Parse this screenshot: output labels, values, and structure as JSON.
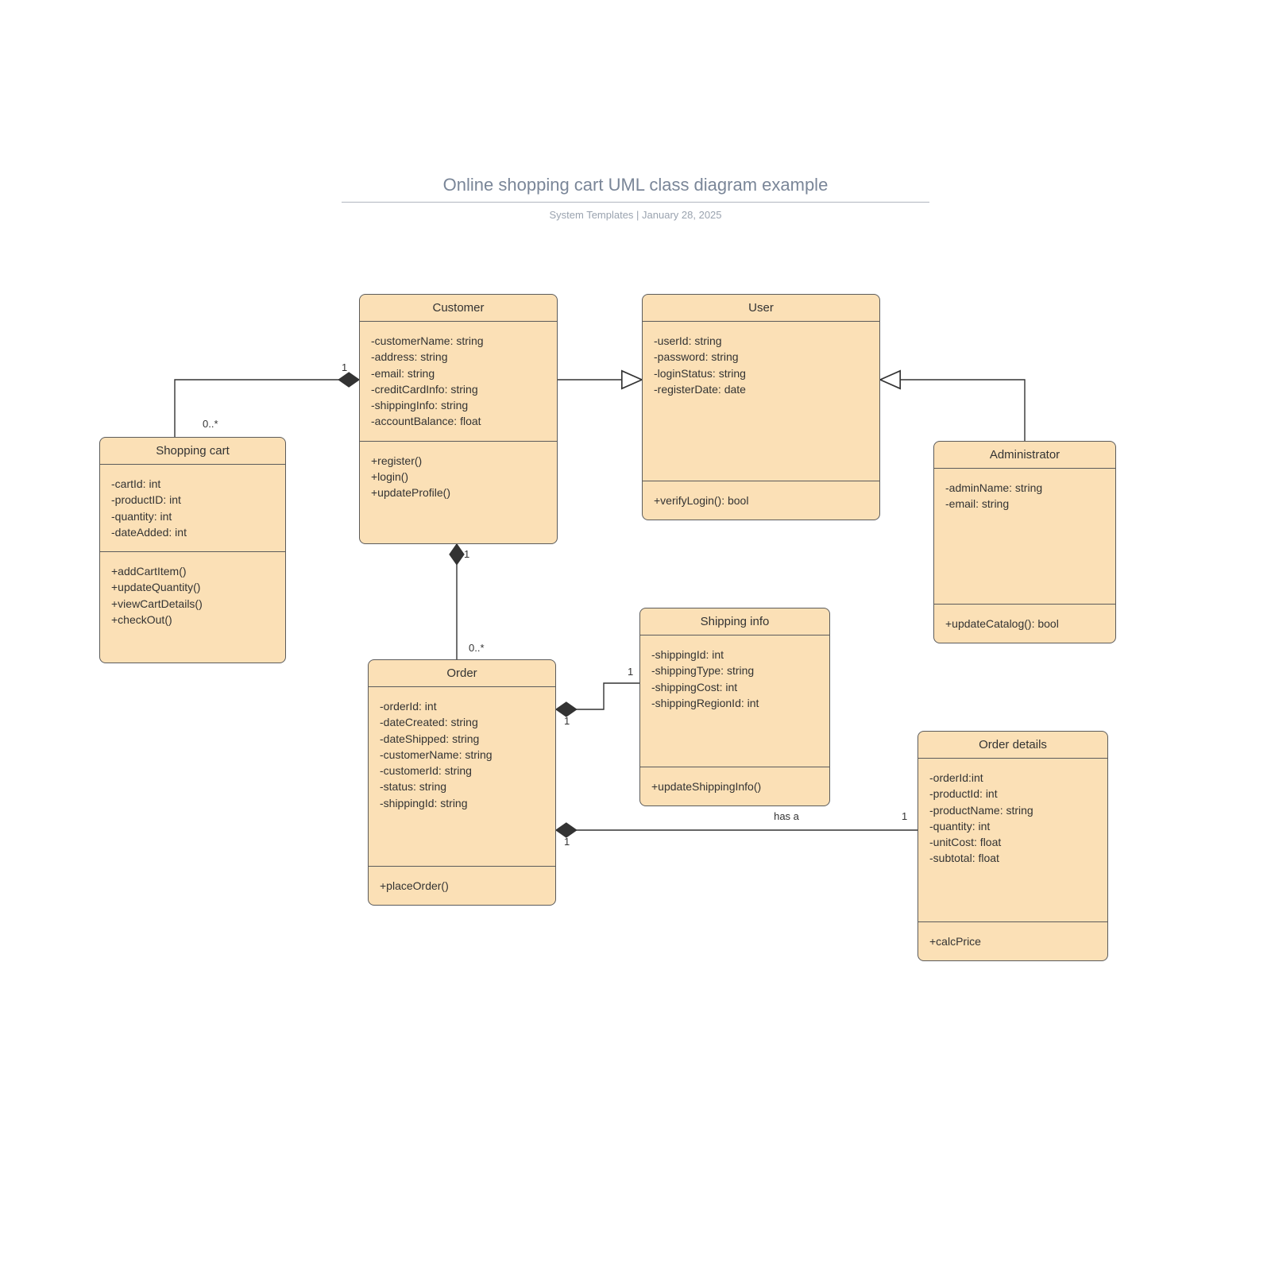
{
  "header": {
    "title": "Online shopping cart UML class diagram example",
    "subtitle_left": "System Templates",
    "subtitle_sep": "  |  ",
    "subtitle_right": "January 28, 2025"
  },
  "classes": {
    "shoppingCart": {
      "name": "Shopping cart",
      "attrs": [
        "-cartId: int",
        "-productID: int",
        "-quantity: int",
        "-dateAdded: int"
      ],
      "ops": [
        "+addCartItem()",
        "+updateQuantity()",
        "+viewCartDetails()",
        "+checkOut()"
      ]
    },
    "customer": {
      "name": "Customer",
      "attrs": [
        "-customerName: string",
        "-address: string",
        "-email: string",
        "-creditCardInfo: string",
        "-shippingInfo: string",
        "-accountBalance: float"
      ],
      "ops": [
        "+register()",
        "+login()",
        "+updateProfile()"
      ]
    },
    "user": {
      "name": "User",
      "attrs": [
        "-userId: string",
        "-password: string",
        "-loginStatus: string",
        "-registerDate: date"
      ],
      "ops": [
        "+verifyLogin(): bool"
      ]
    },
    "administrator": {
      "name": "Administrator",
      "attrs": [
        "-adminName: string",
        "-email: string"
      ],
      "ops": [
        "+updateCatalog(): bool"
      ]
    },
    "order": {
      "name": "Order",
      "attrs": [
        "-orderId: int",
        "-dateCreated: string",
        "-dateShipped: string",
        "-customerName: string",
        "-customerId: string",
        "-status: string",
        "-shippingId: string"
      ],
      "ops": [
        "+placeOrder()"
      ]
    },
    "shippingInfo": {
      "name": "Shipping info",
      "attrs": [
        "-shippingId: int",
        "-shippingType: string",
        "-shippingCost: int",
        "-shippingRegionId: int"
      ],
      "ops": [
        "+updateShippingInfo()"
      ]
    },
    "orderDetails": {
      "name": "Order details",
      "attrs": [
        "-orderId:int",
        "-productId: int",
        "-productName: string",
        "-quantity: int",
        "-unitCost: float",
        "-subtotal: float"
      ],
      "ops": [
        "+calcPrice"
      ]
    }
  },
  "mult": {
    "sc_left": "0..*",
    "sc_right": "1",
    "cust_bottom": "1",
    "order_top": "0..*",
    "order_ship_left": "1",
    "order_ship_right": "1",
    "order_det_left": "1",
    "order_det_right": "1"
  },
  "edgeLabels": {
    "has_a": "has\na"
  }
}
